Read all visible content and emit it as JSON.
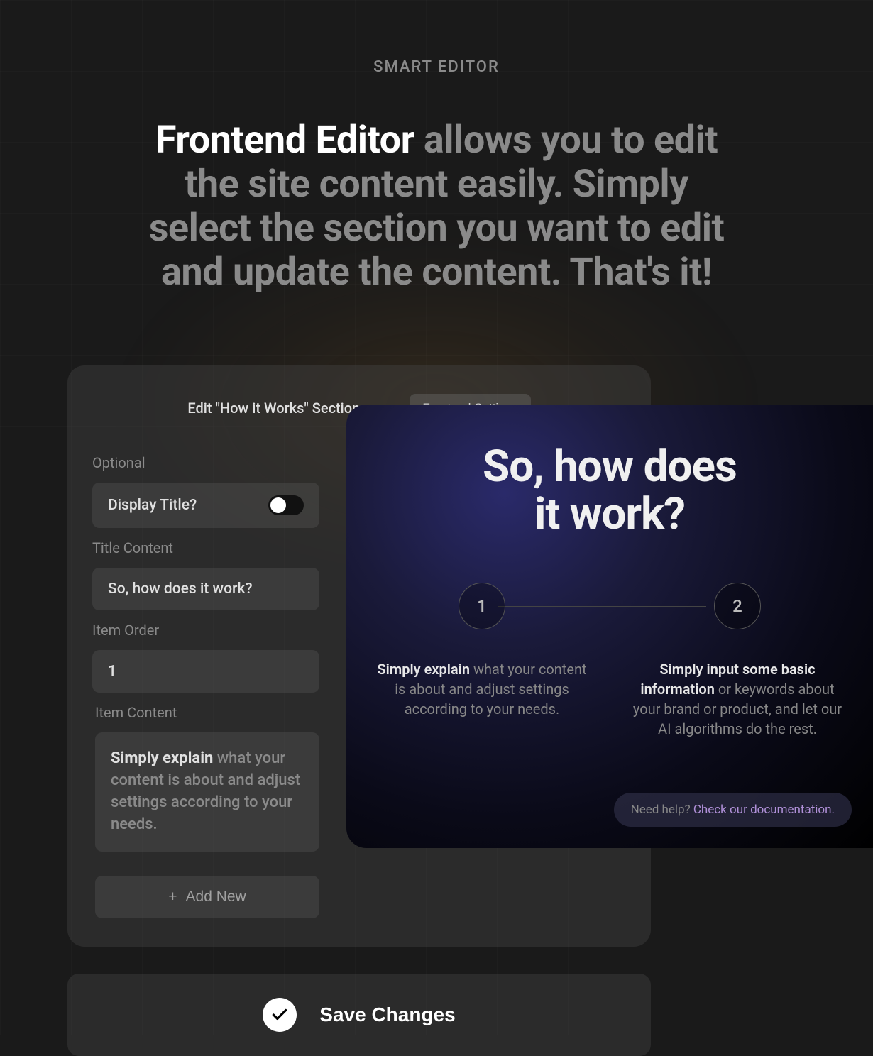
{
  "eyebrow": "SMART EDITOR",
  "headline_bold": "Frontend Editor",
  "headline_rest": " allows you to edit the site content easily. Simply select the section you want to edit and update the content. That's it!",
  "editor": {
    "title": "Edit \"How it Works\" Section",
    "frontend_settings": "Frontend Settings",
    "labels": {
      "optional": "Optional",
      "display_title": "Display Title?",
      "title_content": "Title Content",
      "item_order": "Item Order",
      "item_content": "Item Content"
    },
    "values": {
      "title_content": "So, how does it work?",
      "item_order": "1",
      "item_content_bold": "Simply explain",
      "item_content_rest": " what your content is about and adjust settings according to your needs."
    },
    "add_new": "Add New"
  },
  "preview": {
    "title_line1": "So, how does",
    "title_line2": "it work?",
    "steps": [
      {
        "num": "1",
        "bold": "Simply explain",
        "rest": " what your content is about and adjust settings according to your needs."
      },
      {
        "num": "2",
        "bold": "Simply input some basic information",
        "rest": " or keywords about your brand or product, and let our AI algorithms do the rest."
      }
    ],
    "help_prefix": "Need help? ",
    "help_link": "Check our documentation."
  },
  "save": "Save Changes"
}
